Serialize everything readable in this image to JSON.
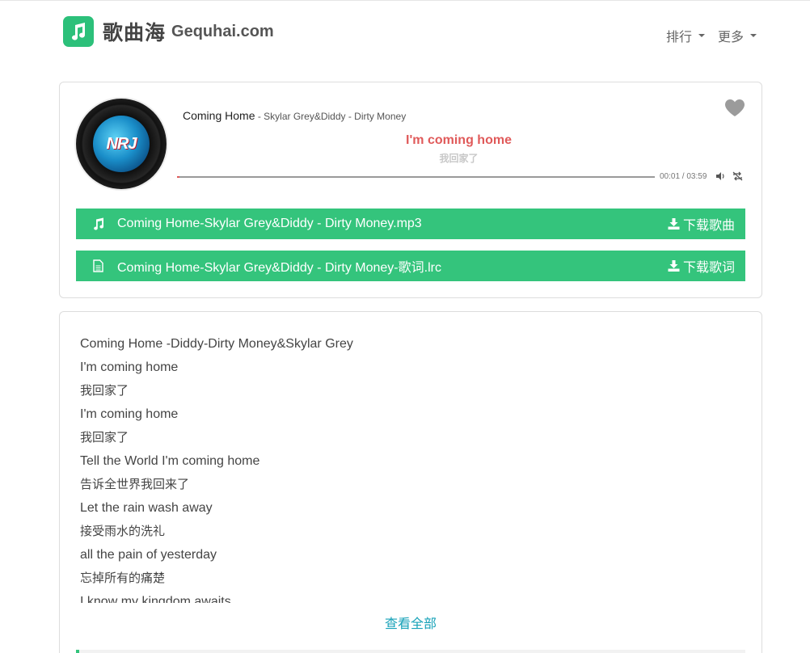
{
  "header": {
    "logo_cn": "歌曲海",
    "logo_en": "Gequhai.com",
    "nav": [
      {
        "label": "排行"
      },
      {
        "label": "更多"
      }
    ]
  },
  "player": {
    "cover_text": "NRJ",
    "song_title": "Coming Home",
    "song_artist": " - Skylar Grey&Diddy - Dirty Money",
    "lyric_current": "I'm coming home",
    "lyric_translation": "我回家了",
    "time_display": "00:01 / 03:59",
    "progress_fraction": 0.004,
    "accent_color": "#e05a5a",
    "downloads": [
      {
        "icon": "music-note-icon",
        "filename": "Coming Home-Skylar Grey&Diddy - Dirty Money.mp3",
        "button": "下载歌曲"
      },
      {
        "icon": "file-icon",
        "filename": "Coming Home-Skylar Grey&Diddy - Dirty Money-歌词.lrc",
        "button": "下载歌词"
      }
    ],
    "download_color": "#34c47c"
  },
  "lyrics": {
    "lines": [
      "Coming Home -Diddy-Dirty Money&Skylar Grey",
      "I'm coming home",
      "我回家了",
      "I'm coming home",
      "我回家了",
      "Tell the World I'm coming home",
      "告诉全世界我回来了",
      "Let the rain wash away",
      "接受雨水的洗礼",
      "all the pain of yesterday",
      "忘掉所有的痛楚",
      "I know my kingdom awaits"
    ],
    "view_all": "查看全部"
  }
}
